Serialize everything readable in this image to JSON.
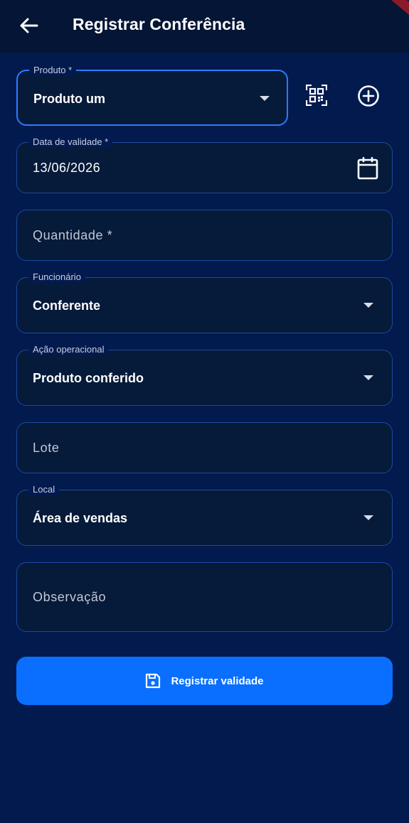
{
  "appbar": {
    "title": "Registrar Conferência",
    "back_icon": "arrow-left-icon"
  },
  "form": {
    "produto": {
      "label": "Produto *",
      "value": "Produto um"
    },
    "validade": {
      "label": "Data de validade *",
      "value": "13/06/2026"
    },
    "quantidade": {
      "placeholder": "Quantidade *"
    },
    "funcionario": {
      "label": "Funcionário",
      "value": "Conferente"
    },
    "acao": {
      "label": "Ação operacional",
      "value": "Produto conferido"
    },
    "lote": {
      "placeholder": "Lote"
    },
    "local": {
      "label": "Local",
      "value": "Área de vendas"
    },
    "observacao": {
      "placeholder": "Observação"
    }
  },
  "actions": {
    "submit_label": "Registrar validade"
  },
  "icons": {
    "scan": "qr-scan-icon",
    "add": "add-circle-icon",
    "calendar": "calendar-icon",
    "save": "save-icon",
    "dropdown": "dropdown-arrow-icon"
  },
  "colors": {
    "background": "#031a4e",
    "appbar": "#041535",
    "field_bg": "#061a3a",
    "field_border": "#1a4aa0",
    "focus_border": "#2d7bff",
    "primary": "#0a6fff"
  }
}
